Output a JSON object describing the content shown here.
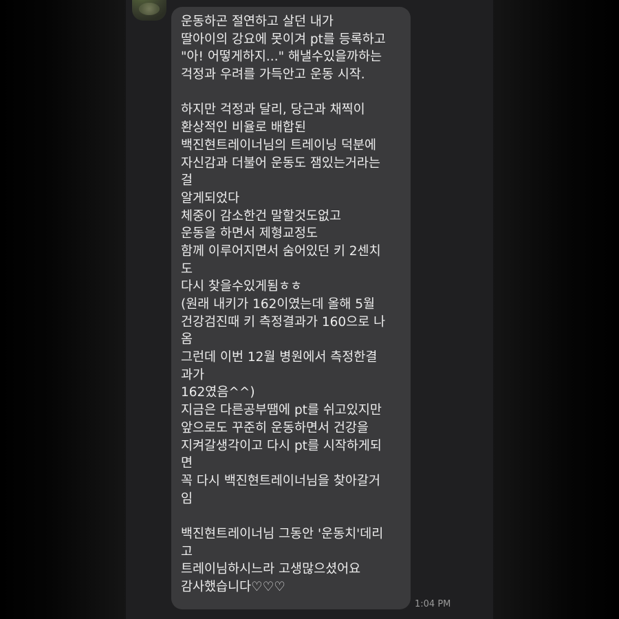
{
  "chat": {
    "sender_header": "~ ~~~~~~ ~ ~~~ ~~ ~~~~~~~ ~~~~ ~~ ~",
    "message_lines": [
      "운동하곤 절연하고 살던 내가",
      "딸아이의 강요에 못이겨 pt를 등록하고",
      "\"아! 어떻게하지...\" 해낼수있을까하는",
      "걱정과 우려를 가득안고 운동 시작.",
      "",
      "하지만 걱정과 달리, 당근과 채찍이",
      "환상적인 비율로 배합된",
      "백진현트레이너님의 트레이닝 덕분에",
      "자신감과 더불어 운동도 잼있는거라는",
      "걸",
      "알게되었다",
      "체중이 감소한건 말할것도없고",
      "운동을 하면서 제형교정도",
      "함께 이루어지면서 숨어있던 키 2센치",
      "도",
      "다시 찾을수있게됨ㅎㅎ",
      "(원래 내키가 162이였는데 올해 5월",
      "건강검진때 키 측정결과가 160으로 나",
      "옴",
      "그런데 이번 12월 병원에서 측정한결",
      "과가",
      "162였음^^)",
      "지금은 다른공부땜에 pt를 쉬고있지만",
      "앞으로도 꾸준히 운동하면서 건강을",
      "지켜갈생각이고 다시 pt를 시작하게되",
      "면",
      "꼭 다시 백진현트레이너님을 찾아갈거",
      "임",
      "",
      "백진현트레이너님 그동안 '운동치'데리",
      "고",
      "트레이님하시느라 고생많으셨어요",
      "감사했습니다♡♡♡"
    ],
    "timestamp": "1:04 PM"
  },
  "colors": {
    "chat_background": "#1f1f21",
    "bubble": "#3a3a3c",
    "message_text": "#ececec",
    "timestamp_text": "#9a9a9a"
  }
}
